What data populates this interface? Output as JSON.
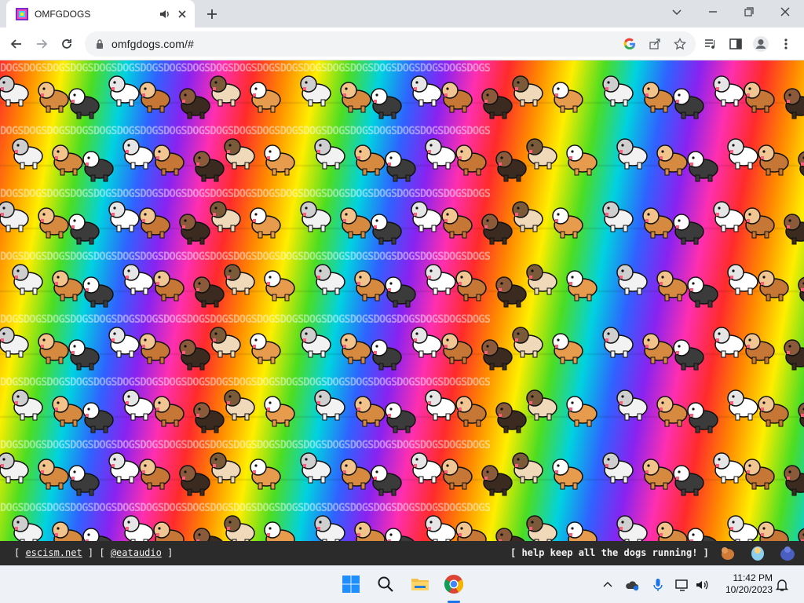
{
  "browser": {
    "tab_title": "OMFGDOGS",
    "url": "omfgdogs.com/#"
  },
  "page": {
    "background_text": "DOGSDOGSDOGSDOGSDOGSDOGSDOGSDOGSDOGSDOGSDOGSDOGSDOGSDOGSDOGSDOGSDOGSDOGSDOGSDOGSDOGS",
    "footer": {
      "left_prefix": "[ ",
      "link1": "escism.net",
      "middle": " ] [ ",
      "link2": "@eataudio",
      "left_suffix": " ]",
      "right_text": "[ help keep all the dogs running! ]"
    }
  },
  "taskbar": {
    "time": "11:42 PM",
    "date": "10/20/2023"
  },
  "colors": {
    "accent": "#1a73e8",
    "tab_strip": "#dee1e6",
    "taskbar": "#eef1f5"
  },
  "icons": [
    "tab-favicon",
    "audio-icon",
    "close-icon",
    "new-tab-icon",
    "chevron-down-icon",
    "minimize-icon",
    "restore-icon",
    "window-close-icon",
    "back-icon",
    "forward-icon",
    "reload-icon",
    "lock-icon",
    "google-icon",
    "share-icon",
    "star-icon",
    "media-control-icon",
    "side-panel-icon",
    "profile-icon",
    "menu-icon",
    "windows-start-icon",
    "search-icon",
    "file-explorer-icon",
    "chrome-icon",
    "chevron-up-icon",
    "onedrive-icon",
    "microphone-icon",
    "display-icon",
    "volume-icon",
    "notification-icon"
  ]
}
